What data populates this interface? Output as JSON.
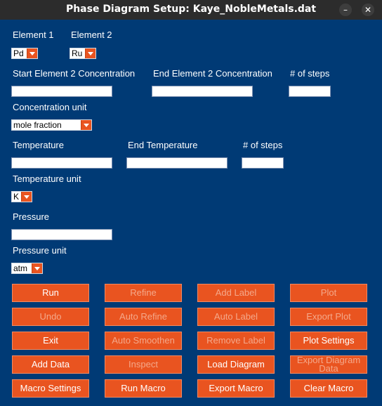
{
  "window": {
    "title": "Phase Diagram Setup: Kaye_NobleMetals.dat",
    "minimize_glyph": "–",
    "close_glyph": "✕"
  },
  "element1": {
    "label": "Element 1",
    "value": "Pd"
  },
  "element2": {
    "label": "Element 2",
    "value": "Ru"
  },
  "concentration": {
    "start_label": "Start Element 2 Concentration",
    "end_label": "End Element 2 Concentration",
    "steps_label": "# of steps",
    "start_value": "",
    "end_value": "",
    "steps_value": "",
    "unit_label": "Concentration unit",
    "unit_value": "mole fraction"
  },
  "temperature": {
    "start_label": "Temperature",
    "end_label": "End Temperature",
    "steps_label": "# of steps",
    "start_value": "",
    "end_value": "",
    "steps_value": "",
    "unit_label": "Temperature unit",
    "unit_value": "K"
  },
  "pressure": {
    "label": "Pressure",
    "value": "",
    "unit_label": "Pressure unit",
    "unit_value": "atm"
  },
  "buttons": {
    "run": "Run",
    "refine": "Refine",
    "add_label": "Add Label",
    "plot": "Plot",
    "undo": "Undo",
    "auto_refine": "Auto Refine",
    "auto_label": "Auto Label",
    "export_plot": "Export Plot",
    "exit": "Exit",
    "auto_smoothen": "Auto Smoothen",
    "remove_label": "Remove Label",
    "plot_settings": "Plot Settings",
    "add_data": "Add Data",
    "inspect": "Inspect",
    "load_diagram": "Load Diagram",
    "export_diagram_data": "Export Diagram Data",
    "macro_settings": "Macro Settings",
    "run_macro": "Run Macro",
    "export_macro": "Export Macro",
    "clear_macro": "Clear Macro"
  },
  "colors": {
    "background": "#003a75",
    "accent": "#e95420",
    "titlebar": "#2c2c2c"
  }
}
